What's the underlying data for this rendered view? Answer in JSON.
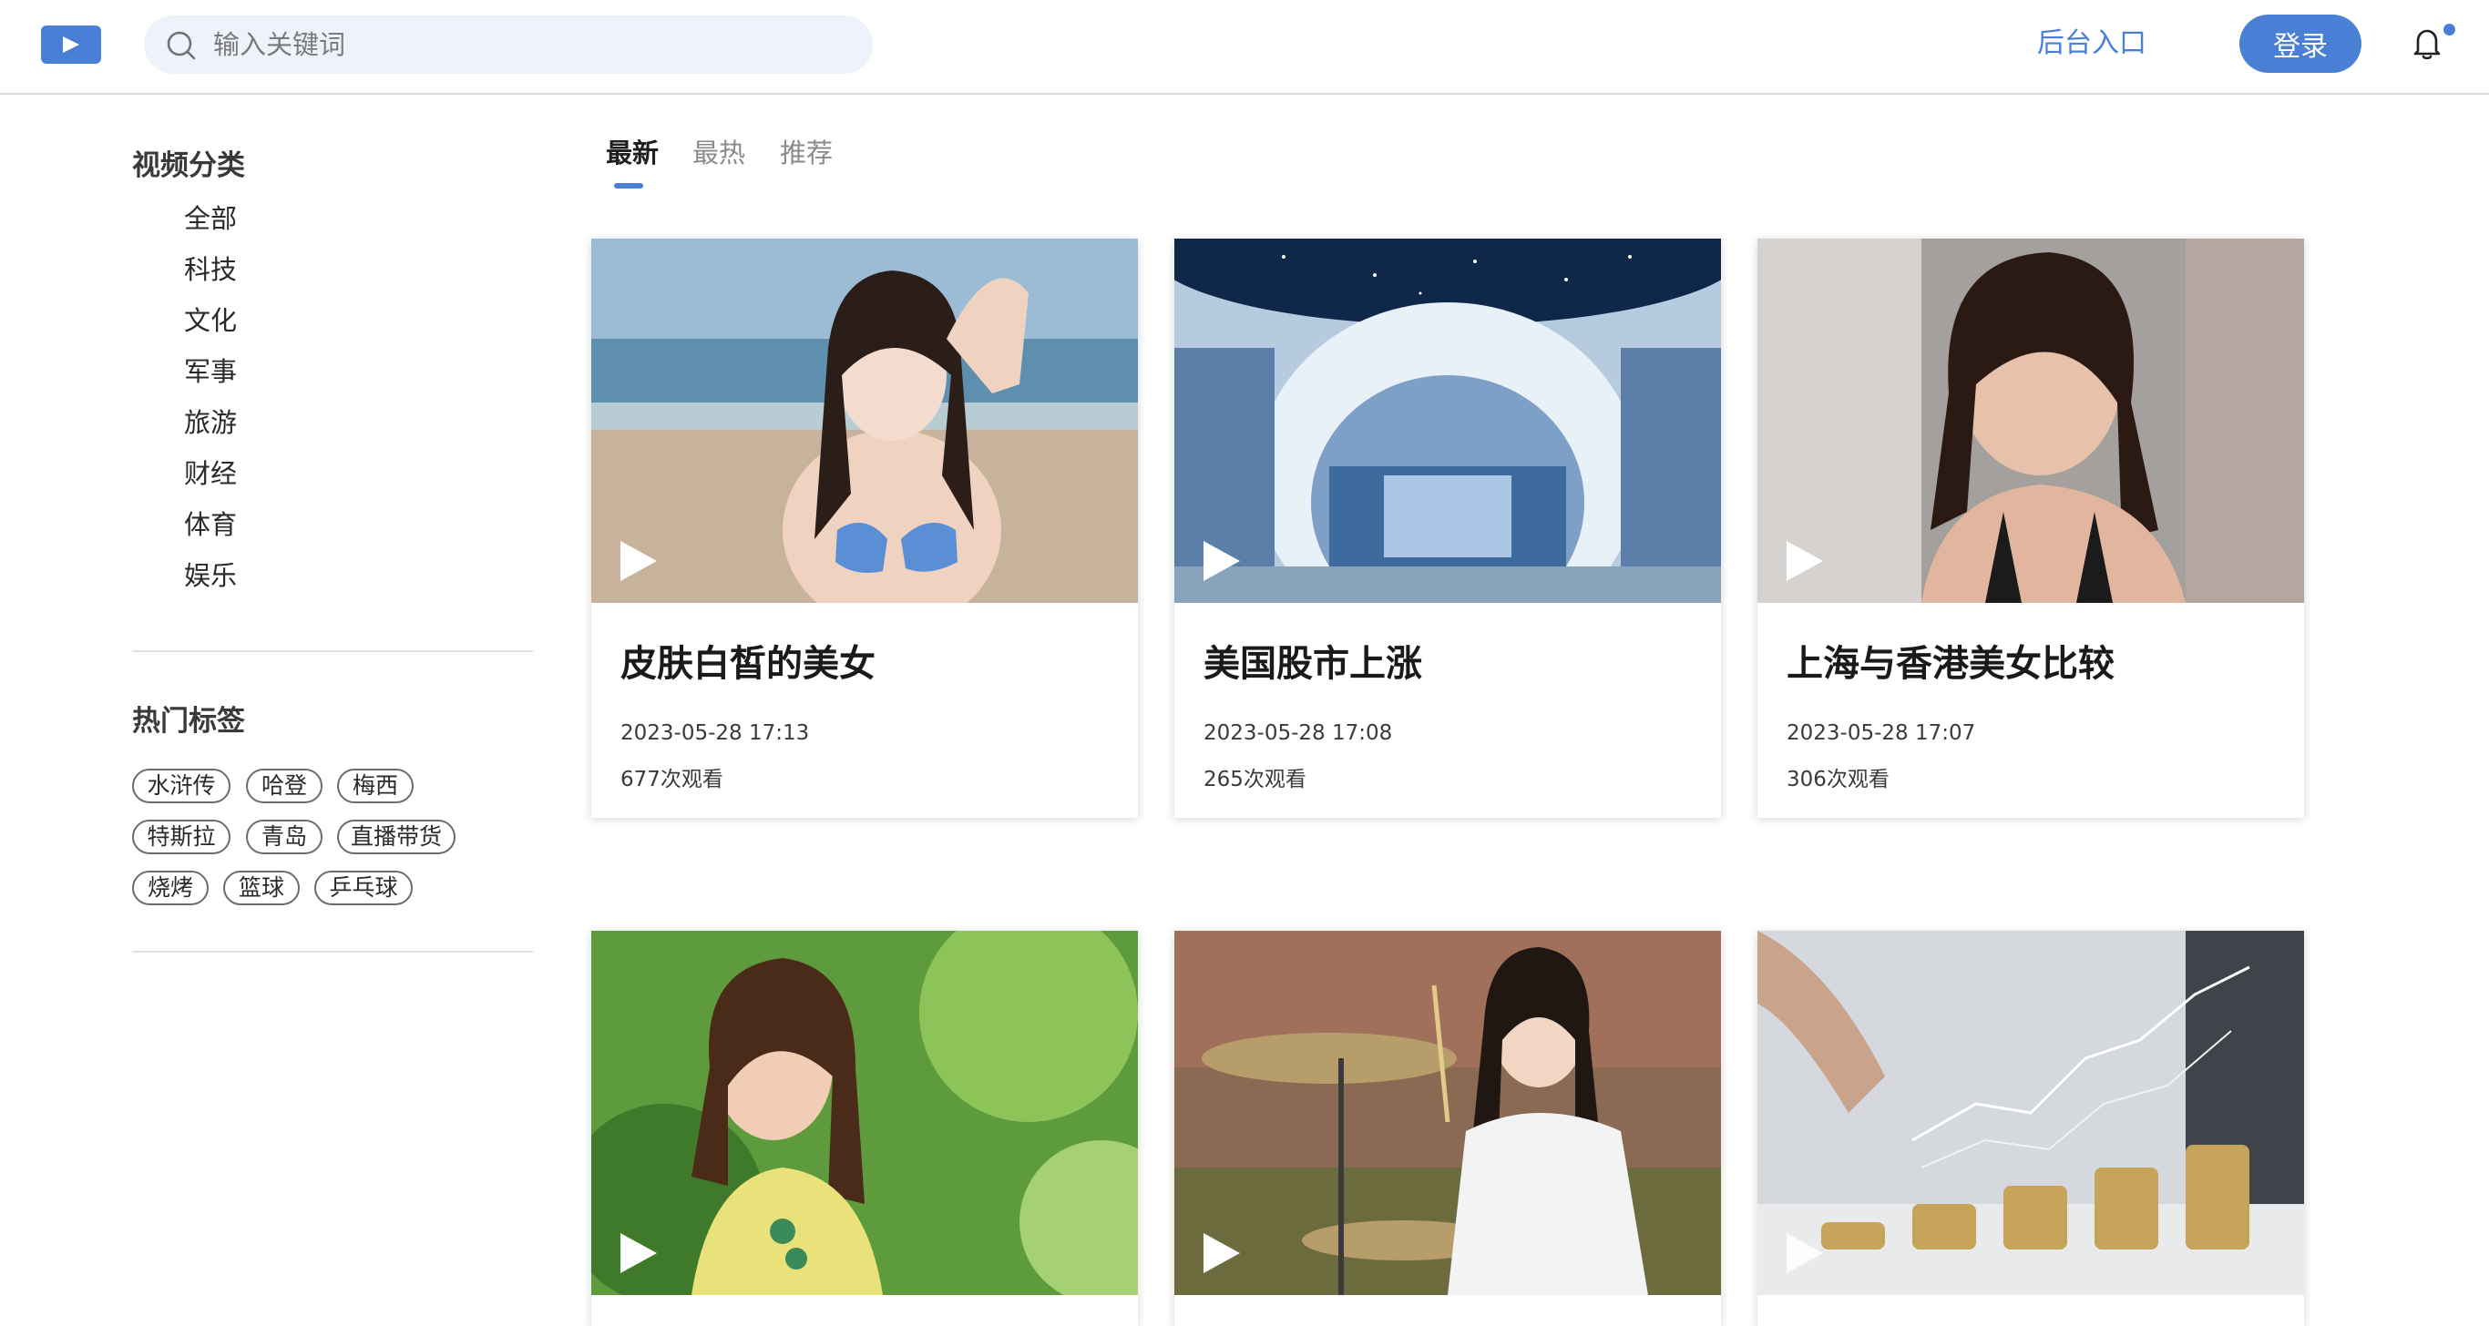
{
  "header": {
    "search_placeholder": "输入关键词",
    "admin_link": "后台入口",
    "login_button": "登录",
    "accent_color": "#4a7fd6"
  },
  "sidebar": {
    "category_title": "视频分类",
    "categories": [
      "全部",
      "科技",
      "文化",
      "军事",
      "旅游",
      "财经",
      "体育",
      "娱乐"
    ],
    "tags_title": "热门标签",
    "tags": [
      "水浒传",
      "哈登",
      "梅西",
      "特斯拉",
      "青岛",
      "直播带货",
      "烧烤",
      "篮球",
      "乒乓球"
    ]
  },
  "tabs": [
    {
      "label": "最新",
      "active": true
    },
    {
      "label": "最热",
      "active": false
    },
    {
      "label": "推荐",
      "active": false
    }
  ],
  "videos": [
    {
      "title": "皮肤白皙的美女",
      "date": "2023-05-28 17:13",
      "views": "677次观看",
      "thumbnail": "beach-portrait"
    },
    {
      "title": "美国股市上涨",
      "date": "2023-05-28 17:08",
      "views": "265次观看",
      "thumbnail": "futuristic-hall"
    },
    {
      "title": "上海与香港美女比较",
      "date": "2023-05-28 17:07",
      "views": "306次观看",
      "thumbnail": "street-portrait"
    },
    {
      "title": "",
      "date": "",
      "views": "",
      "thumbnail": "green-park-portrait"
    },
    {
      "title": "",
      "date": "",
      "views": "",
      "thumbnail": "drummer"
    },
    {
      "title": "",
      "date": "",
      "views": "",
      "thumbnail": "coins-chart"
    }
  ],
  "icons": {
    "logo": "play-logo-icon",
    "search": "search-icon",
    "notification": "bell-icon",
    "thumbnail_overlay": "play-icon"
  }
}
